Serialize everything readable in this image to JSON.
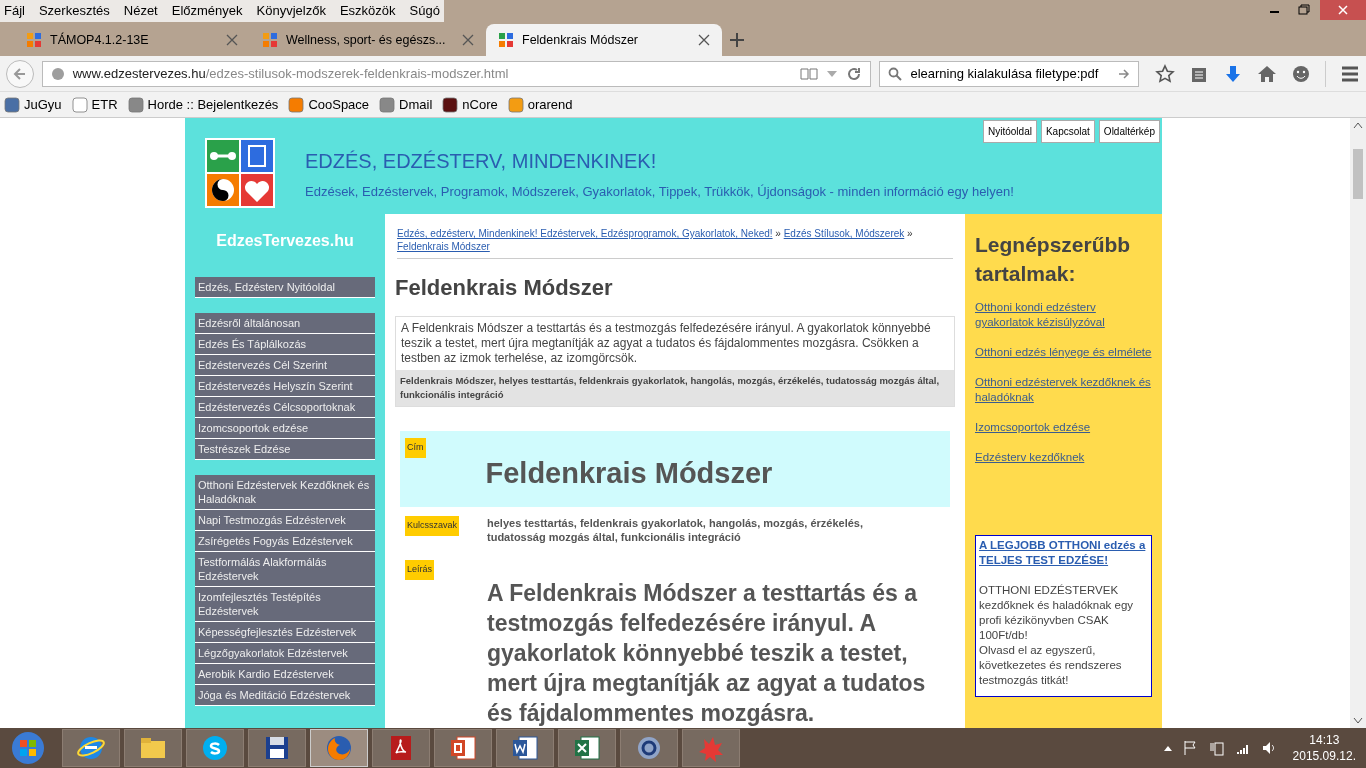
{
  "menu_bar": [
    "Fájl",
    "Szerkesztés",
    "Nézet",
    "Előzmények",
    "Könyvjelzők",
    "Eszközök",
    "Súgó"
  ],
  "tabs": [
    {
      "label": "TÁMOP4.1.2-13E",
      "selected": false
    },
    {
      "label": "Wellness, sport- és egészs...",
      "selected": false
    },
    {
      "label": "Feldenkrais Módszer",
      "selected": true
    }
  ],
  "address_bar": {
    "domain": "www.edzestervezes.hu",
    "path": "/edzes-stilusok-modszerek-feldenkrais-modszer.html"
  },
  "search_field": {
    "value": "elearning kialakulása filetype:pdf"
  },
  "bookmarks": [
    "JuGyu",
    "ETR",
    "Horde :: Bejelentkezés",
    "CooSpace",
    "Dmail",
    "nCore",
    "orarend"
  ],
  "top_links": [
    "Nyitóoldal",
    "Kapcsolat",
    "Oldaltérkép"
  ],
  "site_header": {
    "title": "EDZÉS, EDZÉSTERV, MINDENKINEK!",
    "subtitle": "Edzések, Edzéstervek, Programok, Módszerek, Gyakorlatok, Tippek, Trükkök, Újdonságok - minden információ egy helyen!"
  },
  "sidebar": {
    "title": "EdzesTervezes.hu",
    "groups": [
      [
        "Edzés, Edzésterv Nyitóoldal"
      ],
      [
        "Edzésről általánosan",
        "Edzés És Táplálkozás",
        "Edzéstervezés Cél Szerint",
        "Edzéstervezés Helyszín Szerint",
        "Edzéstervezés Célcsoportoknak",
        "Izomcsoportok edzése",
        "Testrészek Edzése"
      ],
      [
        "Otthoni Edzéstervek Kezdőknek és Haladóknak",
        "Napi Testmozgás Edzéstervek",
        "Zsírégetés Fogyás Edzéstervek",
        "Testformálás Alakformálás Edzéstervek",
        "Izomfejlesztés Testépítés Edzéstervek",
        "Képességfejlesztés Edzéstervek",
        "Légzőgyakorlatok Edzéstervek",
        "Aerobik Kardio Edzéstervek",
        "Jóga és Meditáció Edzéstervek"
      ]
    ]
  },
  "breadcrumb": {
    "links": [
      "Edzés, edzésterv, Mindenkinek! Edzéstervek, Edzésprogramok, Gyakorlatok, Neked!",
      "Edzés Stílusok, Módszerek",
      "Feldenkrais Módszer"
    ],
    "separator": "»"
  },
  "article": {
    "title": "Feldenkrais Módszer",
    "summary": "A Feldenkrais Módszer a testtartás és a testmozgás felfedezésére irányul. A gyakorlatok könnyebbé teszik a testet, mert újra megtanítják az agyat a tudatos és fájdalommentes mozgásra. Csökken a testben az izmok terhelése, az izomgörcsök.",
    "tags": "Feldenkrais Módszer, helyes testtartás, feldenkrais gyakorlatok, hangolás, mozgás, érzékelés, tudatosság mozgás által, funkcionális integráció",
    "fields": [
      {
        "label": "Cím",
        "kind": "title",
        "value": "Feldenkrais Módszer"
      },
      {
        "label": "Kulcsszavak",
        "kind": "keywords",
        "value": "helyes testtartás, feldenkrais gyakorlatok, hangolás, mozgás, érzékelés, tudatosság mozgás által, funkcionális integráció"
      },
      {
        "label": "Leírás",
        "kind": "description",
        "value": "A Feldenkrais Módszer a testtartás és a testmozgás felfedezésére irányul. A gyakorlatok könnyebbé teszik a testet, mert újra megtanítják az agyat a tudatos és fájdalommentes mozgásra."
      }
    ]
  },
  "popular": {
    "title": "Legnépszerűbb tartalmak:",
    "links": [
      "Otthoni kondi edzésterv gyakorlatok kézisúlyzóval",
      "Otthoni edzés lényege és elmélete",
      "Otthoni edzéstervek kezdőknek és haladóknak",
      "Izomcsoportok edzése",
      "Edzésterv kezdőknek"
    ]
  },
  "ad": {
    "title": "A LEGJOBB OTTHONI edzés a TELJES TEST EDZÉSE!",
    "lines": [
      "OTTHONI EDZÉSTERVEK kezdőknek és haladóknak egy profi kézikönyvben CSAK 100Ft/db!",
      "Olvasd el az egyszerű, következetes és rendszeres testmozgás titkát!"
    ]
  },
  "taskbar": {
    "apps": [
      {
        "kind": "ie",
        "selected": false
      },
      {
        "kind": "folder",
        "selected": false
      },
      {
        "kind": "skype",
        "selected": false
      },
      {
        "kind": "disk",
        "selected": false
      },
      {
        "kind": "firefox",
        "selected": true
      },
      {
        "kind": "pdf",
        "selected": false
      },
      {
        "kind": "ppt",
        "selected": false
      },
      {
        "kind": "word",
        "selected": false
      },
      {
        "kind": "excel",
        "selected": false
      },
      {
        "kind": "sync",
        "selected": false
      },
      {
        "kind": "splash",
        "selected": false
      }
    ],
    "time": "14:13",
    "date": "2015.09.12."
  }
}
